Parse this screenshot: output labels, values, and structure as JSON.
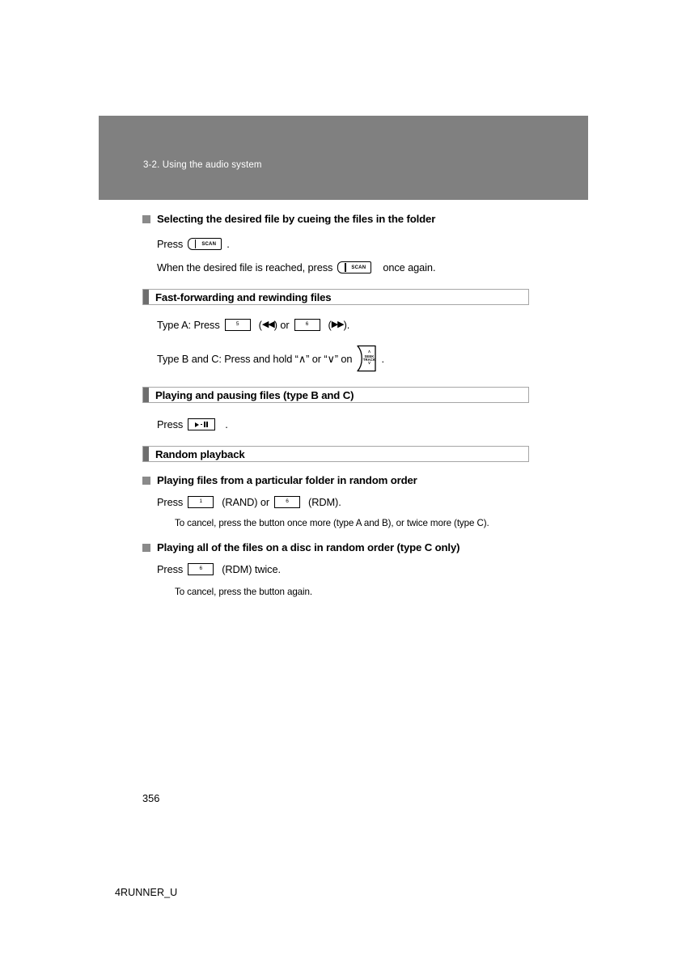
{
  "header": {
    "title": "3-2. Using the audio system"
  },
  "sections": [
    {
      "id": "cueing",
      "type": "subhead",
      "heading": "Selecting the desired file by cueing the files in the folder",
      "line1_prefix": "Press",
      "line1_suffix": ".",
      "line2_prefix": "When the desired file is reached, press",
      "line2_suffix": "once again.",
      "button_label": "SCAN"
    },
    {
      "id": "fast-forward",
      "type": "section",
      "title": "Fast-forwarding and rewinding files",
      "typeA_prefix": "Type A: Press",
      "typeA_mid_open": "(",
      "typeA_rew_glyph": "◀◀",
      "typeA_mid_close": ") or",
      "typeA_ff_glyph": "▶▶",
      "typeA_end": ").",
      "typeA_btn1": "5",
      "typeA_btn2": "6",
      "typeBC_prefix": "Type B and C: Press and hold “∧” or “∨” on",
      "typeBC_suffix": ".",
      "seek_up": "∧",
      "seek_word1": "SEEK",
      "seek_word2": "TRACK",
      "seek_down": "∨"
    },
    {
      "id": "play-pause",
      "type": "section",
      "title": "Playing and pausing files (type B and C)",
      "line1_prefix": "Press",
      "line1_suffix": "."
    },
    {
      "id": "random",
      "type": "section",
      "title": "Random playback",
      "sub1": {
        "heading": "Playing files from a particular folder in random order",
        "line_prefix": "Press",
        "btn1": "1",
        "mid1": "(RAND) or",
        "btn2": "6",
        "mid2": "(RDM).",
        "note": "To cancel, press the button once more (type A and B), or twice more (type C)."
      },
      "sub2": {
        "heading": "Playing all of the files on a disc in random order (type C only)",
        "line_prefix": "Press",
        "btn1": "6",
        "mid1": "(RDM) twice.",
        "note": "To cancel, press the button again."
      }
    }
  ],
  "footer": {
    "page_number": "356",
    "model_code": "4RUNNER_U"
  },
  "colors": {
    "header_band": "#808080",
    "section_tab": "#6e6e6e",
    "bullet": "#8a8a8a",
    "section_border": "#a6a6a6"
  }
}
